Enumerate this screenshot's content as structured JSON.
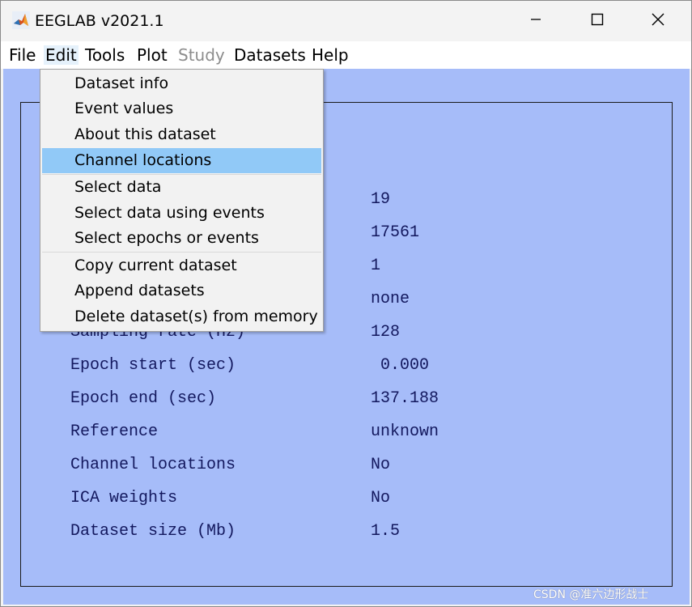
{
  "window": {
    "title": "EEGLAB v2021.1",
    "icon": "matlab-logo-icon",
    "controls": {
      "minimize": "minimize-icon",
      "maximize": "maximize-icon",
      "close": "close-icon"
    }
  },
  "menubar": {
    "items": [
      "File",
      "Edit",
      "Tools",
      "Plot",
      "Study",
      "Datasets",
      "Help"
    ],
    "disabled": [
      "Study"
    ],
    "open_menu": "Edit"
  },
  "edit_menu": {
    "items": [
      "Dataset info",
      "Event values",
      "About this dataset",
      "Channel locations",
      "Select data",
      "Select data using events",
      "Select epochs or events",
      "Copy current dataset",
      "Append datasets",
      "Delete dataset(s) from memory"
    ],
    "highlighted": "Channel locations"
  },
  "dataset_info": {
    "header_fragment": ")",
    "rows": [
      {
        "label": "",
        "value": "19"
      },
      {
        "label": "",
        "value": "17561"
      },
      {
        "label": "",
        "value": "1"
      },
      {
        "label": "",
        "value": "none"
      },
      {
        "label": "Sampling rate (Hz)",
        "value": "128"
      },
      {
        "label": "Epoch start (sec)",
        "value": " 0.000"
      },
      {
        "label": "Epoch end (sec)",
        "value": "137.188"
      },
      {
        "label": "Reference",
        "value": "unknown"
      },
      {
        "label": "Channel locations",
        "value": "No"
      },
      {
        "label": "ICA weights",
        "value": "No"
      },
      {
        "label": "Dataset size (Mb)",
        "value": "1.5"
      }
    ]
  },
  "watermark": "CSDN @准六边形战士",
  "colors": {
    "canvas_bg": "#a6bcf9",
    "text": "#13185e",
    "highlight": "#91c9f7",
    "disabled": "#8d8d8d"
  }
}
